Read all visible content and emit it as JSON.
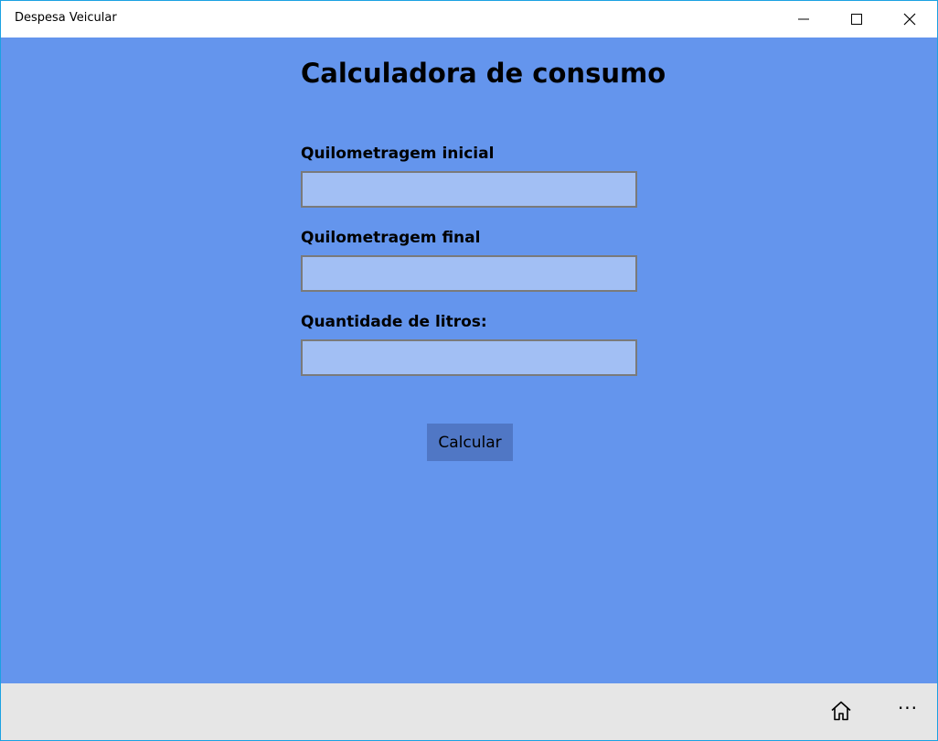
{
  "window": {
    "title": "Despesa Veicular",
    "controls": {
      "minimize_icon": "minimize-icon",
      "maximize_icon": "maximize-icon",
      "close_icon": "close-icon"
    }
  },
  "form": {
    "heading": "Calculadora de consumo",
    "fields": [
      {
        "label": "Quilometragem inicial",
        "value": "",
        "placeholder": ""
      },
      {
        "label": "Quilometragem final",
        "value": "",
        "placeholder": ""
      },
      {
        "label": "Quantidade de litros:",
        "value": "",
        "placeholder": ""
      }
    ],
    "submit_label": "Calcular"
  },
  "appbar": {
    "home_icon": "home-icon",
    "more_icon": "more-icon",
    "more_glyph": "···"
  },
  "colors": {
    "background": "#6495ed",
    "field_background": "#a2bff4",
    "button_background": "#5077c5",
    "appbar_background": "#e6e6e6",
    "window_border": "#1ba1e2"
  }
}
